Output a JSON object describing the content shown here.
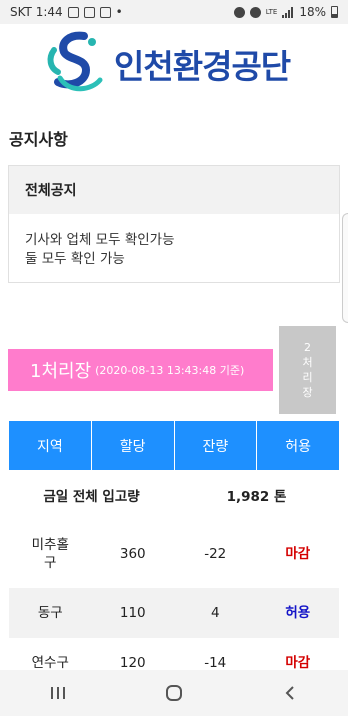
{
  "status_bar": {
    "carrier_time": "SKT 1:44",
    "network": "LTE",
    "battery": "18%"
  },
  "logo": {
    "text": "인천환경공단"
  },
  "section_title": "공지사항",
  "notice": {
    "header": "전체공지",
    "lines": [
      "기사와 업체 모두 확인가능",
      "둘 모두 확인 가능"
    ]
  },
  "plants": {
    "active": {
      "name": "1처리장",
      "timestamp": "(2020-08-13 13:43:48 기준)"
    },
    "other": {
      "chars": [
        "2",
        "처",
        "리",
        "장"
      ]
    }
  },
  "table": {
    "headers": [
      "지역",
      "할당",
      "잔량",
      "허용"
    ],
    "total": {
      "label": "금일 전체 입고량",
      "value": "1,982 톤"
    },
    "rows": [
      {
        "region_lines": [
          "미추홀",
          "구"
        ],
        "quota": "360",
        "remaining": "-22",
        "status": "마감"
      },
      {
        "region_lines": [
          "동구"
        ],
        "quota": "110",
        "remaining": "4",
        "status": "허용"
      },
      {
        "region_lines": [
          "연수구"
        ],
        "quota": "120",
        "remaining": "-14",
        "status": "마감"
      }
    ]
  },
  "colors": {
    "logo_blue": "#1f4aa8",
    "plant_active": "#ff7ccc",
    "plant_inactive": "#c8c8c8",
    "table_header": "#1e90ff",
    "status_closed": "#d40000",
    "status_open": "#1414c8"
  },
  "icons": {
    "status_bar": [
      "chat-icon",
      "image-icon",
      "photo-icon",
      "more-dots-icon",
      "alarm-icon",
      "mute-icon",
      "signal-icon",
      "battery-icon"
    ],
    "navigation": [
      "recent-apps-icon",
      "home-icon",
      "back-icon"
    ]
  }
}
